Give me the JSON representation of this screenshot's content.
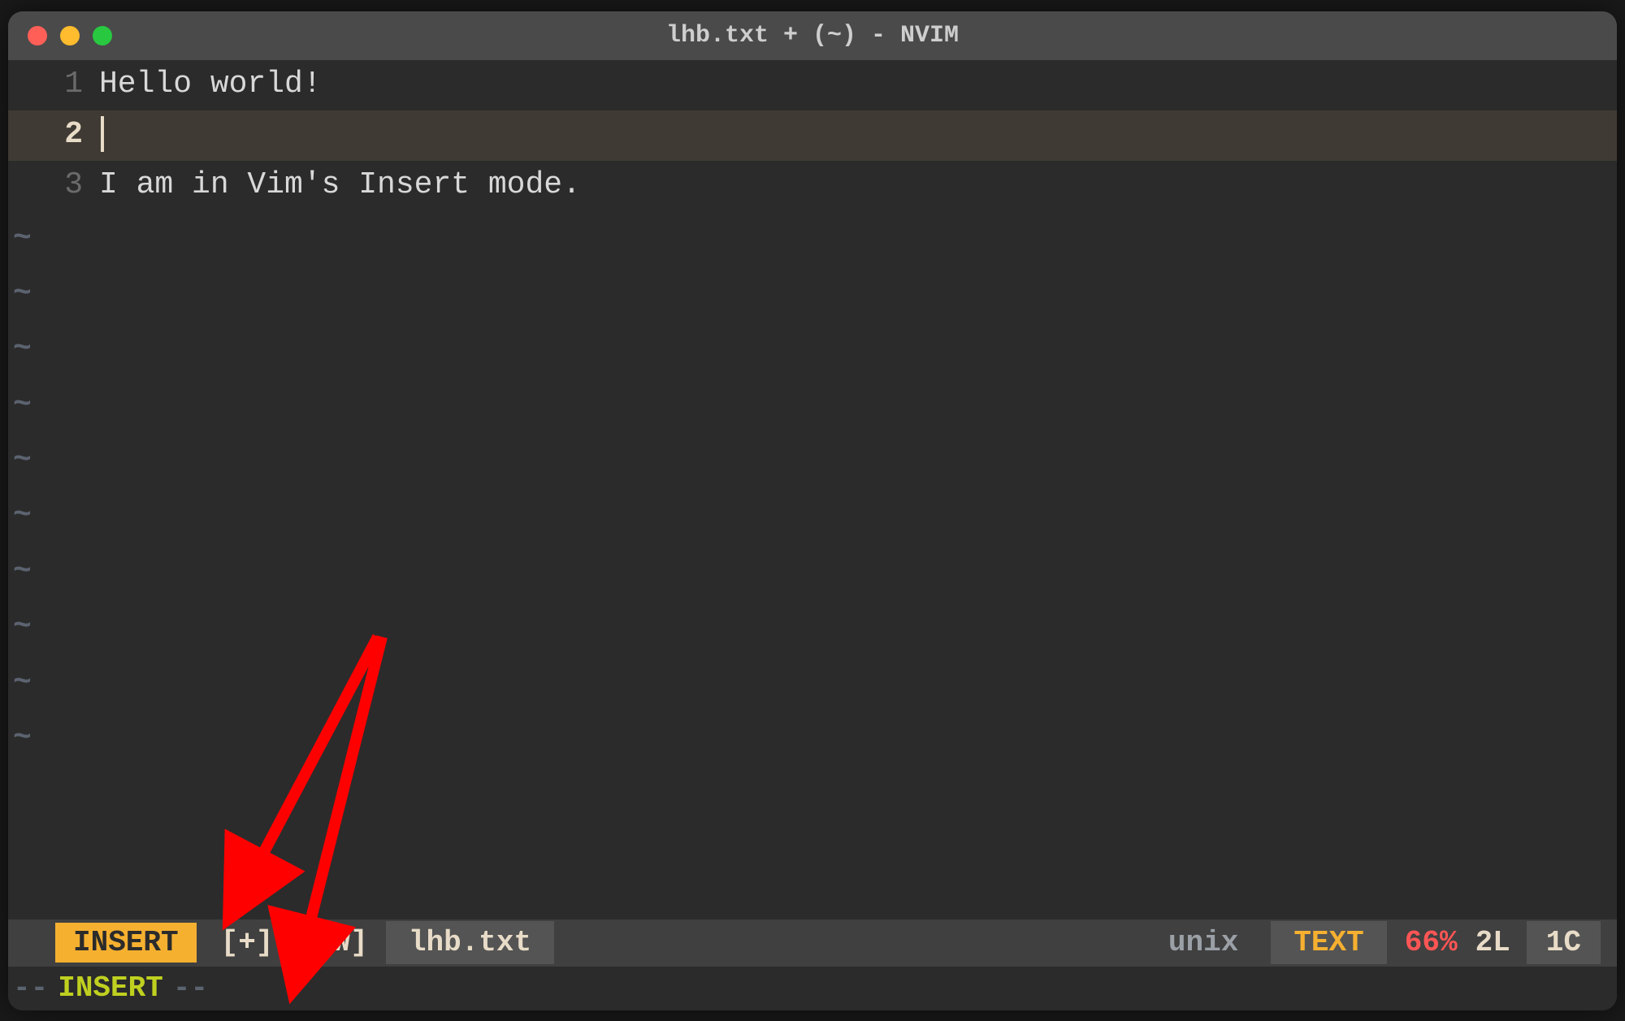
{
  "window": {
    "title": "lhb.txt + (~) - NVIM"
  },
  "editor": {
    "lines": [
      {
        "num": "1",
        "text": "Hello world!",
        "current": false
      },
      {
        "num": "2",
        "text": "",
        "current": true
      },
      {
        "num": "3",
        "text": "I am in Vim's Insert mode.",
        "current": false
      }
    ],
    "tildes_count": 10
  },
  "statusline": {
    "mode": " INSERT ",
    "modified": "[+]",
    "readwrite": "[RW]",
    "filename": "lhb.txt",
    "fileformat": "unix",
    "filetype": "TEXT",
    "percent": "66%",
    "line_indicator": "2L",
    "col_indicator": "1C"
  },
  "commandline": {
    "dashes_left": "--",
    "mode": "INSERT",
    "dashes_right": "--"
  }
}
